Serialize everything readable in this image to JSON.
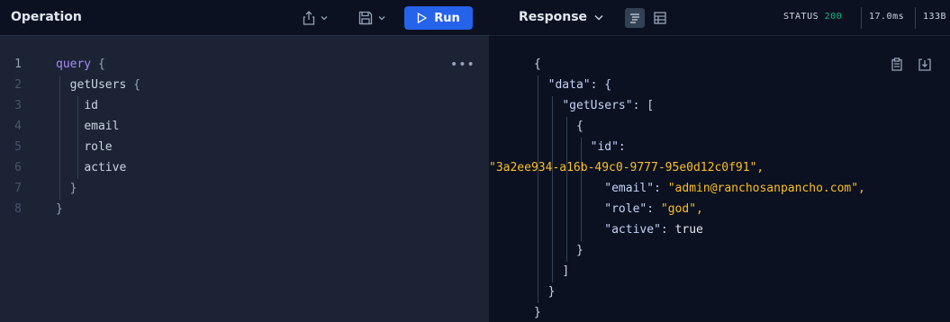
{
  "operation": {
    "title": "Operation",
    "run_label": "Run",
    "lines": [
      "1",
      "2",
      "3",
      "4",
      "5",
      "6",
      "7",
      "8"
    ],
    "code": {
      "query_kw": "query",
      "query_brace": "{",
      "field_getUsers": "getUsers",
      "getUsers_brace": "{",
      "fields": [
        "id",
        "email",
        "role",
        "active"
      ],
      "close_inner": "}",
      "close_outer": "}"
    },
    "more": "•••"
  },
  "response": {
    "title": "Response",
    "status_label": "STATUS",
    "status_code": "200",
    "time": "17.0ms",
    "size": "133B",
    "json": {
      "open": "{",
      "data_key": "\"data\": {",
      "getUsers_key": "\"getUsers\": [",
      "obj_open": "{",
      "id_key": "\"id\":",
      "id_value": "\"3a2ee934-a16b-49c0-9777-95e0d12c0f91\",",
      "email_key": "\"email\": ",
      "email_value": "\"admin@ranchosanpancho.com\",",
      "role_key": "\"role\": ",
      "role_value": "\"god\",",
      "active_key": "\"active\": ",
      "active_value": "true",
      "obj_close": "}",
      "arr_close": "]",
      "data_close": "}",
      "close": "}"
    }
  },
  "icons": {
    "share": "share-icon",
    "save": "save-icon",
    "play": "play-icon",
    "chevron": "chevron-down-icon",
    "text_view": "text-view-icon",
    "table_view": "table-view-icon",
    "copy": "copy-icon",
    "download": "download-icon",
    "more": "more-icon"
  },
  "colors": {
    "accent": "#2563eb",
    "status_ok": "#10b981",
    "string": "#fbbf24",
    "keyword": "#a78bfa"
  }
}
